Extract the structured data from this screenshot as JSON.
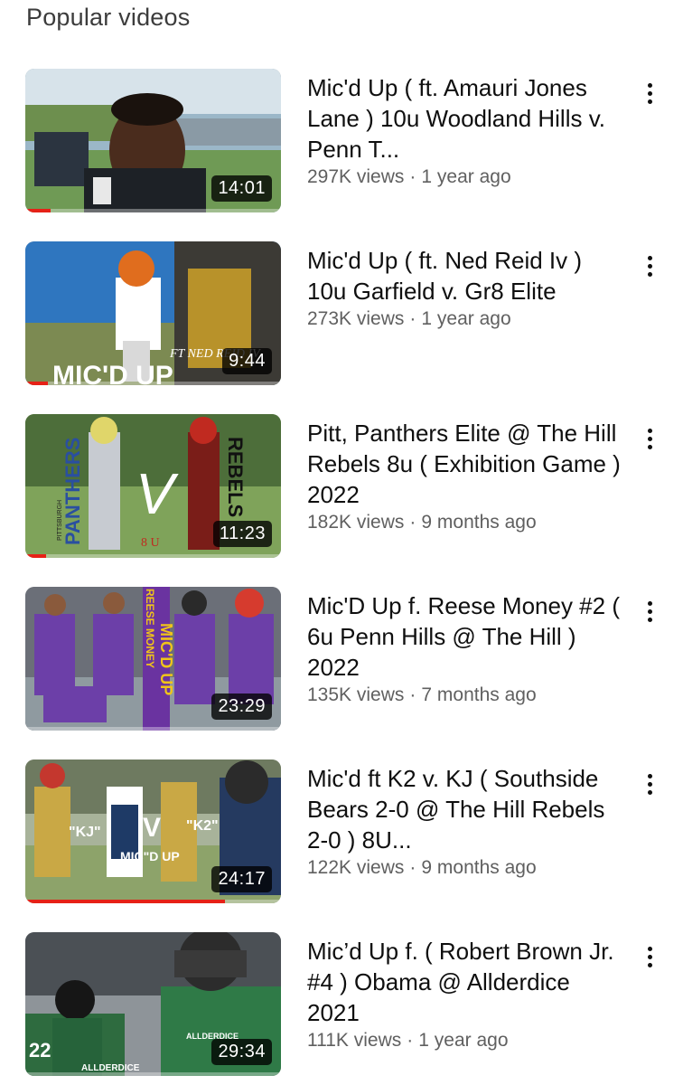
{
  "section": {
    "title": "Popular videos"
  },
  "videos": [
    {
      "title": "Mic'd Up ( ft. Amauri Jones Lane ) 10u Woodland Hills v. Penn T...",
      "views": "297K views",
      "age": "1 year ago",
      "duration": "14:01",
      "watched_fraction": 0.1
    },
    {
      "title": "Mic'd Up ( ft. Ned Reid Iv ) 10u Garfield v. Gr8 Elite",
      "views": "273K views",
      "age": "1 year ago",
      "duration": "9:44",
      "watched_fraction": 0.09,
      "thumb_text": [
        "MIC'D UP",
        "FT NED REID IV"
      ]
    },
    {
      "title": "Pitt, Panthers Elite @ The Hill Rebels 8u (  Exhibition Game ) 2022",
      "views": "182K views",
      "age": "9 months ago",
      "duration": "11:23",
      "watched_fraction": 0.08,
      "thumb_text": [
        "PANTHERS",
        "V",
        "REBELS",
        "8 U",
        "PITTSBURGH"
      ]
    },
    {
      "title": "Mic'D Up f. Reese Money #2 ( 6u Penn Hills @ The Hill ) 2022",
      "views": "135K views",
      "age": "7 months ago",
      "duration": "23:29",
      "watched_fraction": 0.0,
      "thumb_text": [
        "MIC'D UP",
        "REESE MONEY"
      ]
    },
    {
      "title": "Mic'd ft K2 v. KJ ( Southside Bears 2-0 @ The Hill Rebels 2-0 ) 8U...",
      "views": "122K views",
      "age": "9 months ago",
      "duration": "24:17",
      "watched_fraction": 0.78,
      "thumb_text": [
        "\"KJ\"",
        "V",
        "\"K2\"",
        "MIC\"D UP"
      ]
    },
    {
      "title": "Mic’d Up f. ( Robert Brown Jr. #4 ) Obama @ Allderdice 2021",
      "views": "111K views",
      "age": "1 year ago",
      "duration": "29:34",
      "watched_fraction": 0.0,
      "thumb_text": [
        "ALLDERDICE",
        "ALLDERDICE",
        "22"
      ]
    }
  ],
  "icons": {
    "more": "more-vert-icon"
  },
  "colors": {
    "progress": "#e62117",
    "meta_text": "#606060",
    "title_text": "#0f0f0f"
  }
}
